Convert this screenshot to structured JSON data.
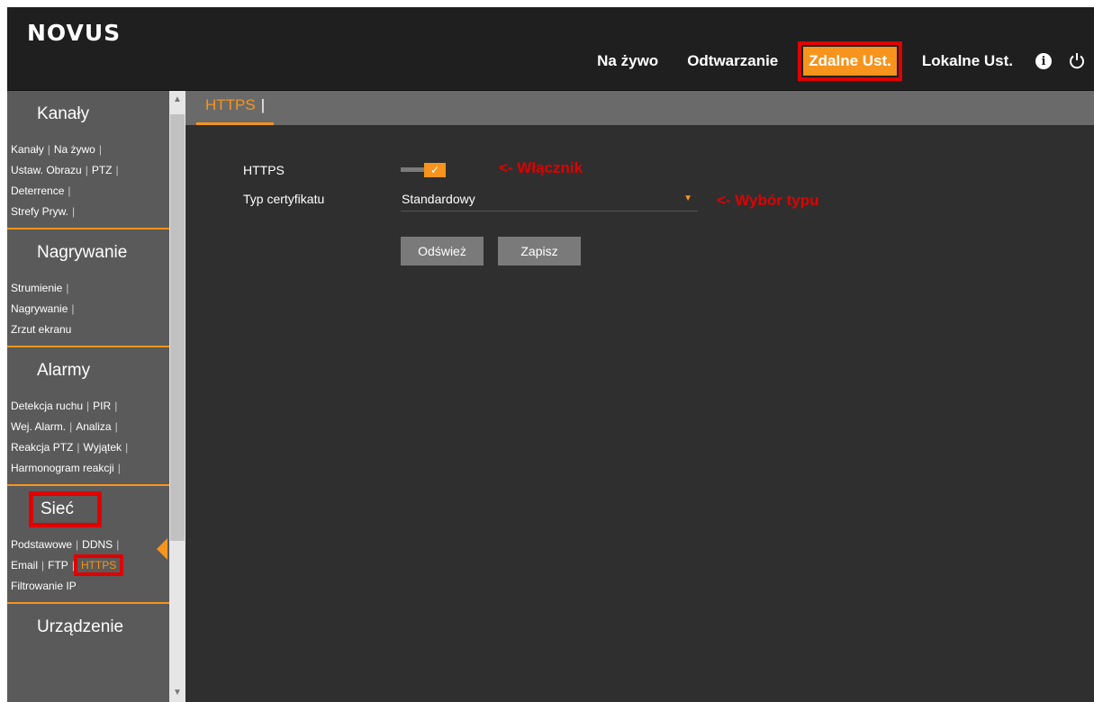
{
  "header": {
    "logo": "NOVUS",
    "nav": [
      {
        "label": "Na żywo"
      },
      {
        "label": "Odtwarzanie"
      },
      {
        "label": "Zdalne Ust."
      },
      {
        "label": "Lokalne Ust."
      }
    ],
    "icons": [
      "info-icon",
      "power-icon"
    ]
  },
  "sidebar": {
    "sections": [
      {
        "title": "Kanały",
        "lines": [
          [
            "Kanały",
            "Na żywo"
          ],
          [
            "Ustaw. Obrazu",
            "PTZ"
          ],
          [
            "Deterrence"
          ],
          [
            "Strefy Pryw."
          ]
        ]
      },
      {
        "title": "Nagrywanie",
        "lines": [
          [
            "Strumienie"
          ],
          [
            "Nagrywanie"
          ],
          [
            "Zrzut ekranu"
          ]
        ]
      },
      {
        "title": "Alarmy",
        "lines": [
          [
            "Detekcja ruchu",
            "PIR"
          ],
          [
            "Wej. Alarm.",
            "Analiza"
          ],
          [
            "Reakcja PTZ",
            "Wyjątek"
          ],
          [
            "Harmonogram reakcji"
          ]
        ]
      },
      {
        "title": "Sieć",
        "lines": [
          [
            "Podstawowe",
            "DDNS"
          ],
          [
            "Email",
            "FTP",
            "HTTPS"
          ],
          [
            "Filtrowanie IP"
          ]
        ]
      },
      {
        "title": "Urządzenie",
        "lines": []
      }
    ]
  },
  "content": {
    "tab": "HTTPS",
    "https_label": "HTTPS",
    "https_enabled": true,
    "cert_label": "Typ certyfikatu",
    "cert_value": "Standardowy",
    "refresh_button": "Odśwież",
    "save_button": "Zapisz"
  },
  "annotations": {
    "switch": "<- Włącznik",
    "type": "<- Wybór typu"
  },
  "colors": {
    "accent": "#f7941d",
    "highlight": "#e00000",
    "background": "#2f2f2f",
    "sidebar": "#5a5a5a"
  }
}
